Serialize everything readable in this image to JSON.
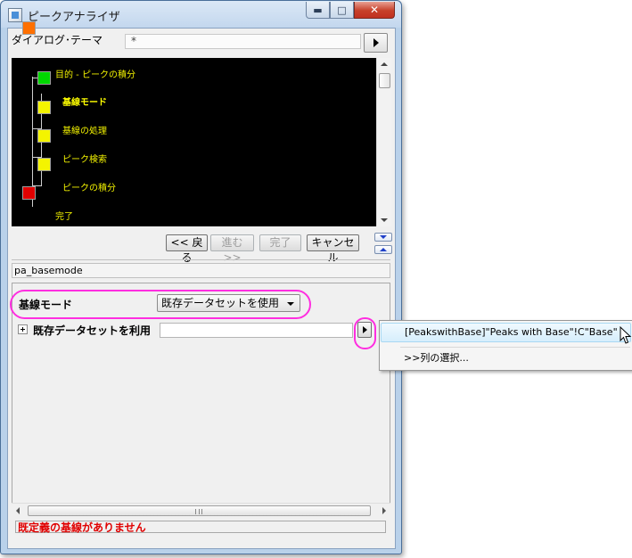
{
  "window": {
    "title": "ピークアナライザ",
    "controls": {
      "minimize": "▬",
      "maximize": "□",
      "close": "✕"
    }
  },
  "theme": {
    "label": "ダイアログ･テーマ",
    "value": "*"
  },
  "flow": {
    "steps": [
      {
        "label": "目的 - ピークの積分",
        "color": "#ff7000",
        "active": false
      },
      {
        "label": "基線モード",
        "color": "#00d800",
        "active": true
      },
      {
        "label": "基線の処理",
        "color": "#f4f400",
        "active": false
      },
      {
        "label": "ピーク検索",
        "color": "#f4f400",
        "active": false
      },
      {
        "label": "ピークの積分",
        "color": "#f4f400",
        "active": false
      },
      {
        "label": "完了",
        "color": "#e00000",
        "active": false
      }
    ]
  },
  "nav": {
    "back": "<< 戻る",
    "next": "進む >>",
    "finish": "完了",
    "cancel": "キャンセル"
  },
  "description": "pa_basemode",
  "params": {
    "basemode_label": "基線モード",
    "basemode_value": "既存データセットを使用",
    "use_dataset_label": "既存データセットを利用",
    "use_dataset_value": ""
  },
  "status": "既定義の基線がありません",
  "popup": {
    "items": [
      "[PeakswithBase]\"Peaks with Base\"!C\"Base\"",
      ">>列の選択..."
    ]
  },
  "colors": {
    "highlight_ring": "#ff2ee0",
    "status_text": "#e00000",
    "flow_background": "#000000",
    "flow_label": "#f2f200"
  }
}
